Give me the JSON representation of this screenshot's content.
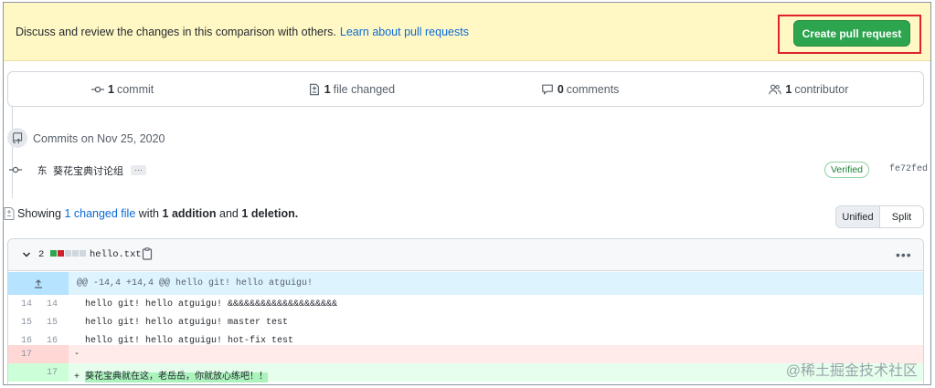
{
  "banner": {
    "text": "Discuss and review the changes in this comparison with others.",
    "link": "Learn about pull requests",
    "button": "Create pull request"
  },
  "stats": [
    {
      "count": "1",
      "label": "commit",
      "icon": "git-commit-icon"
    },
    {
      "count": "1",
      "label": "file changed",
      "icon": "file-diff-icon"
    },
    {
      "count": "0",
      "label": "comments",
      "icon": "comment-icon"
    },
    {
      "count": "1",
      "label": "contributor",
      "icon": "people-icon"
    }
  ],
  "commits": {
    "date_heading": "Commits on Nov 25, 2020",
    "items": [
      {
        "author_avatar_char": "东",
        "message": "葵花宝典讨论组",
        "ellipsis": "…",
        "badge": "Verified",
        "sha": "fe72fed"
      }
    ]
  },
  "showing": {
    "prefix": "Showing",
    "changed_count": "1",
    "changed_label": "changed file",
    "with": "with",
    "additions": "1",
    "additions_label": "addition",
    "and": "and",
    "deletions": "1",
    "deletions_label": "deletion."
  },
  "view_toggle": {
    "unified": "Unified",
    "split": "Split",
    "selected": "Unified"
  },
  "file": {
    "changes": "2",
    "name": "hello.txt",
    "hunk_header": "@@ -14,4 +14,4 @@ hello git! hello atguigu!",
    "lines": [
      {
        "old": "14",
        "new": "14",
        "type": "context",
        "text": "  hello git! hello atguigu! &&&&&&&&&&&&&&&&&&&&"
      },
      {
        "old": "15",
        "new": "15",
        "type": "context",
        "text": "  hello git! hello atguigu! master test"
      },
      {
        "old": "16",
        "new": "16",
        "type": "context",
        "text": "  hello git! hello atguigu! hot-fix test"
      },
      {
        "old": "17",
        "new": "",
        "type": "deletion",
        "text": "-"
      },
      {
        "old": "",
        "new": "17",
        "type": "addition",
        "sign": "+ ",
        "text": "葵花宝典就在这，老岳岳，你就放心练吧！！"
      }
    ]
  },
  "watermark": "@稀土掘金技术社区",
  "colors": {
    "accent": "#0969da",
    "button_green": "#2da44e",
    "highlight_border": "#e0232b",
    "banner_bg": "#fff8c5"
  }
}
